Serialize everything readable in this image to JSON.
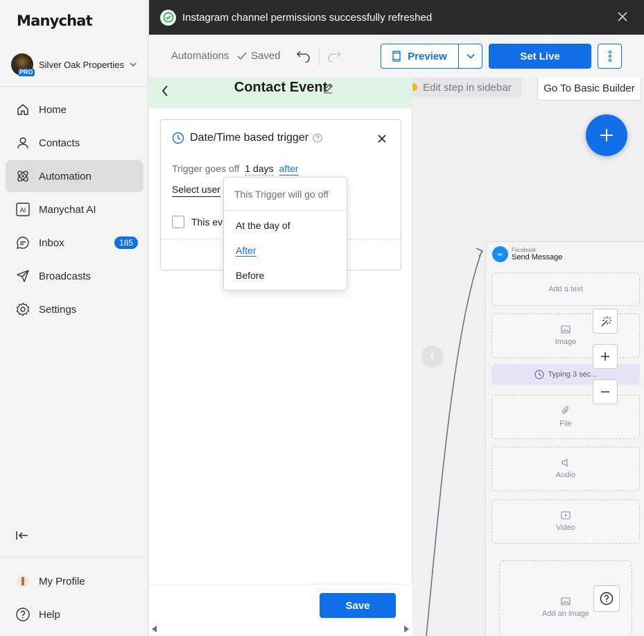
{
  "app": {
    "logo": "Manychat"
  },
  "account": {
    "name": "Silver Oak Properties",
    "badge": "PRO"
  },
  "sidebar": {
    "items": [
      {
        "label": "Home",
        "icon": "home-icon"
      },
      {
        "label": "Contacts",
        "icon": "user-icon"
      },
      {
        "label": "Automation",
        "icon": "atom-icon",
        "active": true
      },
      {
        "label": "Manychat AI",
        "icon": "ai-icon"
      },
      {
        "label": "Inbox",
        "icon": "chat-icon",
        "count": "185"
      },
      {
        "label": "Broadcasts",
        "icon": "send-icon"
      },
      {
        "label": "Settings",
        "icon": "gear-icon"
      }
    ],
    "bottom": [
      {
        "label": "My Profile",
        "icon": "avatar"
      },
      {
        "label": "Help",
        "icon": "help-icon"
      }
    ]
  },
  "toast": {
    "text": "Instagram channel permissions successfully refreshed"
  },
  "toolbar": {
    "breadcrumb": "Automations",
    "status": "Saved",
    "preview_label": "Preview",
    "setlive_label": "Set Live"
  },
  "panel": {
    "title": "Contact Event",
    "trigger": {
      "title": "Date/Time based trigger",
      "goes_off_label": "Trigger goes off",
      "days_value": "1 days",
      "timing_value": "after",
      "select_user": "Select user",
      "checkbox_label": "This ev"
    },
    "dropdown": {
      "header": "This Trigger will go off",
      "options": [
        "At the day of",
        "After",
        "Before"
      ],
      "selected": "After"
    },
    "save_label": "Save"
  },
  "canvas": {
    "edit_hint": "Edit step in sidebar",
    "basic_builder": "Go To Basic Builder",
    "card": {
      "channel": "Facebook",
      "title": "Send Message",
      "slots": [
        "Add a text",
        "Image",
        "File",
        "Audio",
        "Video",
        "Add an image"
      ],
      "typing": "Typing 3 sec..."
    }
  },
  "colors": {
    "accent": "#1170e8",
    "panel_header": "#dff4e4",
    "toast_bg": "#2a2a2c"
  }
}
